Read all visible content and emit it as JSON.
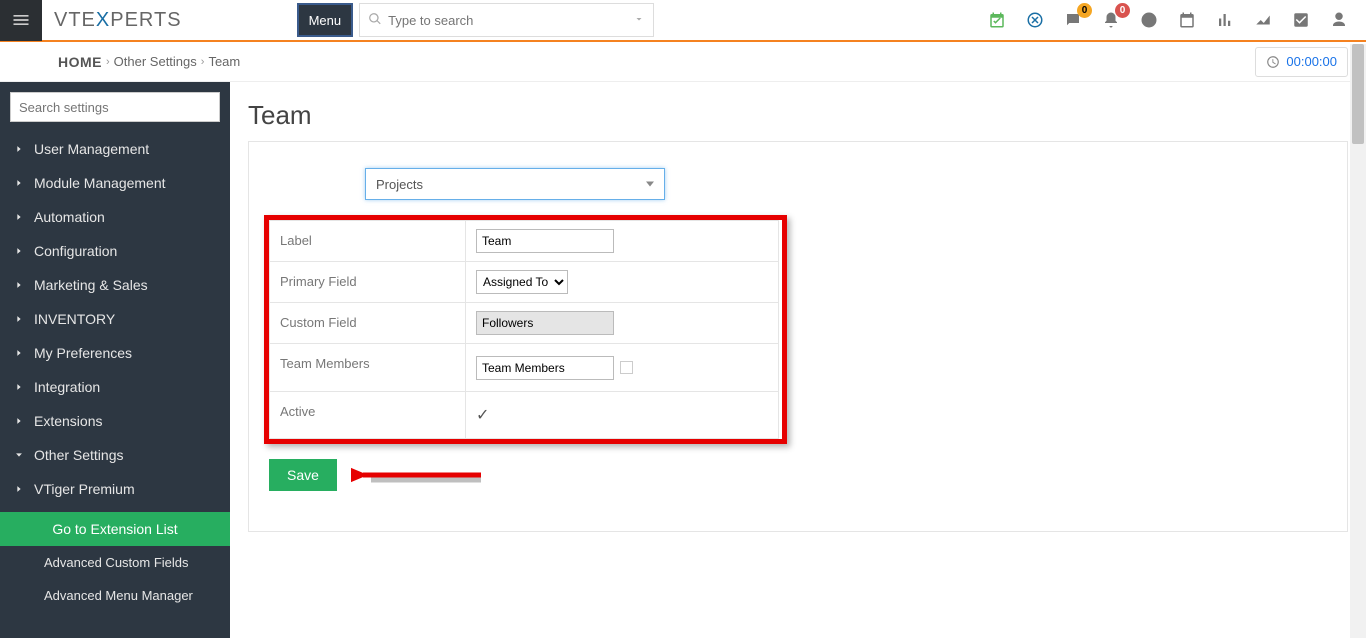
{
  "header": {
    "brand_prefix": "VTE",
    "brand_mid": "X",
    "brand_suffix": "PERTS",
    "menu_label": "Menu",
    "search_placeholder": "Type to search",
    "badge_chat": "0",
    "badge_bell": "0"
  },
  "breadcrumb": {
    "home": "HOME",
    "item1": "Other Settings",
    "item2": "Team",
    "timer": "00:00:00"
  },
  "sidebar": {
    "search_placeholder": "Search settings",
    "items": [
      {
        "label": "User Management"
      },
      {
        "label": "Module Management"
      },
      {
        "label": "Automation"
      },
      {
        "label": "Configuration"
      },
      {
        "label": "Marketing & Sales"
      },
      {
        "label": "INVENTORY"
      },
      {
        "label": "My Preferences"
      },
      {
        "label": "Integration"
      },
      {
        "label": "Extensions"
      },
      {
        "label": "Other Settings"
      },
      {
        "label": "VTiger Premium"
      }
    ],
    "go_ext": "Go to Extension List",
    "sub1": "Advanced Custom Fields",
    "sub2": "Advanced Menu Manager"
  },
  "main": {
    "title": "Team",
    "module_selected": "Projects",
    "form": {
      "label_caption": "Label",
      "label_value": "Team",
      "primary_caption": "Primary Field",
      "primary_value": "Assigned To",
      "custom_caption": "Custom Field",
      "custom_value": "Followers",
      "members_caption": "Team Members",
      "members_value": "Team Members",
      "active_caption": "Active"
    },
    "save_label": "Save"
  }
}
